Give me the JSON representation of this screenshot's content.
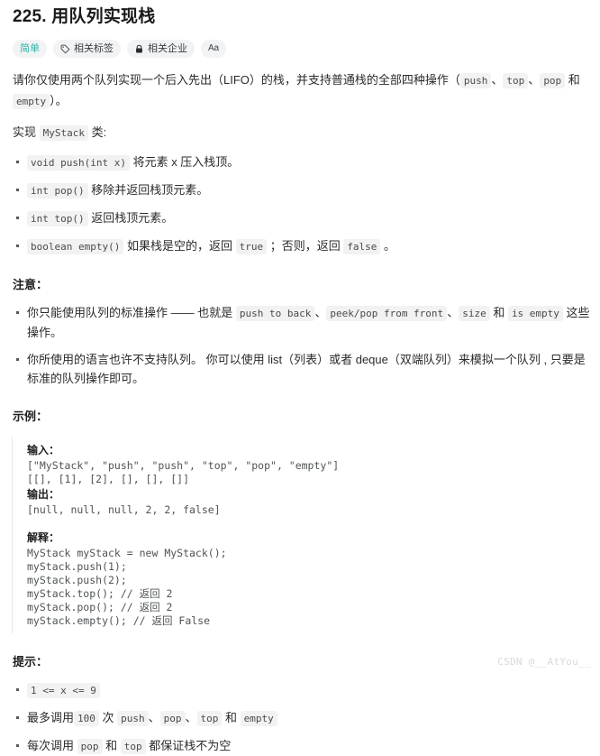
{
  "problem": {
    "title": "225. 用队列实现栈",
    "difficulty_label": "简单",
    "difficulty_color": "#2db3a6",
    "meta_buttons": [
      {
        "label": "相关标签",
        "icon": "tag-icon"
      },
      {
        "label": "相关企业",
        "icon": "lock-icon"
      }
    ],
    "font_size_button": "Aa"
  },
  "description": {
    "intro_1": "请你仅使用两个队列实现一个后入先出（LIFO）的栈，并支持普通栈的全部四种操作（",
    "intro_code_1": "push",
    "intro_sep_1": "、",
    "intro_code_2": "top",
    "intro_sep_2": "、",
    "intro_code_3": "pop",
    "intro_sep_3": " 和 ",
    "intro_code_4": "empty",
    "intro_end": "）。",
    "implement_prefix": "实现 ",
    "implement_code": "MyStack",
    "implement_suffix": " 类:",
    "methods": [
      {
        "code": "void push(int x)",
        "text": " 将元素 x 压入栈顶。"
      },
      {
        "code": "int pop()",
        "text": " 移除并返回栈顶元素。"
      },
      {
        "code": "int top()",
        "text": " 返回栈顶元素。"
      },
      {
        "code": "boolean empty()",
        "text_before": " 如果栈是空的，返回 ",
        "code_2": "true",
        "text_mid": " ；否则，返回 ",
        "code_3": "false",
        "text_after": " 。"
      }
    ]
  },
  "notes": {
    "heading": "注意：",
    "item_1": {
      "prefix": "你只能使用队列的标准操作 —— 也就是 ",
      "code_1": "push to back",
      "sep_1": "、",
      "code_2": "peek/pop from front",
      "sep_2": "、",
      "code_3": "size",
      "sep_3": " 和 ",
      "code_4": "is empty",
      "suffix": " 这些操作。"
    },
    "item_2": "你所使用的语言也许不支持队列。 你可以使用 list（列表）或者 deque（双端队列）来模拟一个队列 , 只要是标准的队列操作即可。"
  },
  "example": {
    "heading": "示例：",
    "input_label": "输入：",
    "input_lines": [
      "[\"MyStack\", \"push\", \"push\", \"top\", \"pop\", \"empty\"]",
      "[[], [1], [2], [], [], []]"
    ],
    "output_label": "输出：",
    "output_lines": [
      "[null, null, null, 2, 2, false]"
    ],
    "explain_label": "解释：",
    "explain_lines": [
      "MyStack myStack = new MyStack();",
      "myStack.push(1);",
      "myStack.push(2);",
      "myStack.top(); // 返回 2",
      "myStack.pop(); // 返回 2",
      "myStack.empty(); // 返回 False"
    ]
  },
  "hints": {
    "heading": "提示：",
    "item_1_code": "1 <= x <= 9",
    "item_2": {
      "prefix": "最多调用",
      "code_1": "100",
      "mid_1": " 次 ",
      "code_2": "push",
      "sep_1": "、",
      "code_3": "pop",
      "sep_2": "、",
      "code_4": "top",
      "sep_3": " 和 ",
      "code_5": "empty"
    },
    "item_3": {
      "prefix": "每次调用 ",
      "code_1": "pop",
      "mid": " 和 ",
      "code_2": "top",
      "suffix": " 都保证栈不为空"
    }
  },
  "watermark": "CSDN @__AtYou__"
}
